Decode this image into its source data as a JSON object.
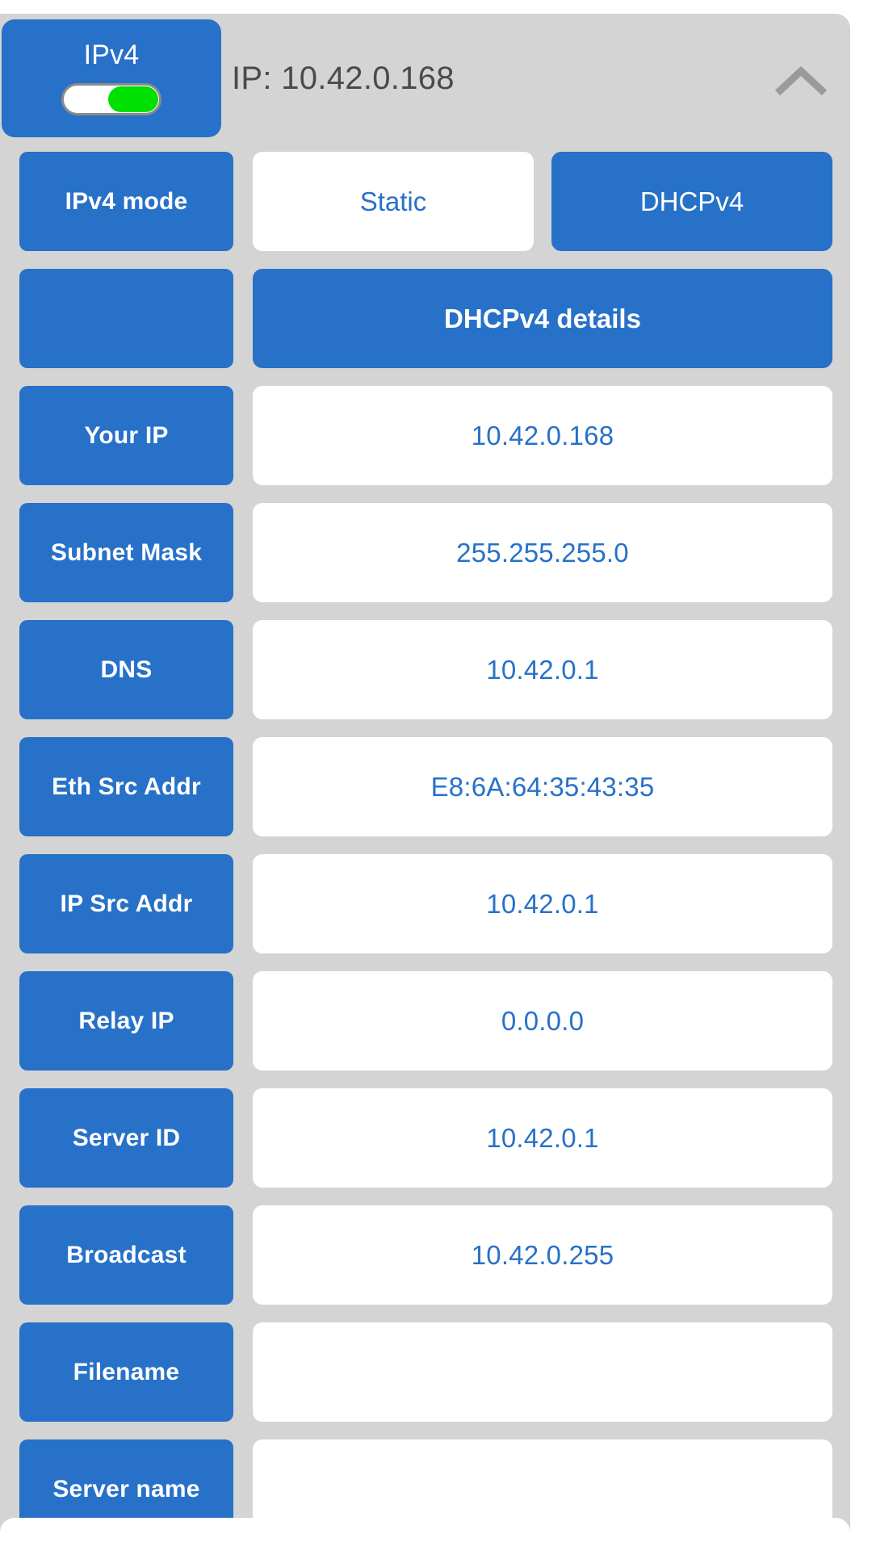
{
  "theme": {
    "accent_blue": "#2771c8",
    "panel_gray": "#d4d4d4",
    "toggle_on_green": "#00e000",
    "header_text_gray": "#4a4a4a",
    "card_white": "#ffffff"
  },
  "header": {
    "protocol_label": "IPv4",
    "toggle_state": "on",
    "ip_summary": "IP: 10.42.0.168",
    "collapse_icon": "chevron-up-icon"
  },
  "mode_row": {
    "label": "IPv4 mode",
    "options": [
      {
        "label": "Static",
        "selected": false
      },
      {
        "label": "DHCPv4",
        "selected": true
      }
    ]
  },
  "details_row": {
    "label": "",
    "button_label": "DHCPv4 details"
  },
  "detail_rows": [
    {
      "label": "Your IP",
      "value": "10.42.0.168"
    },
    {
      "label": "Subnet Mask",
      "value": "255.255.255.0"
    },
    {
      "label": "DNS",
      "value": "10.42.0.1"
    },
    {
      "label": "Eth Src Addr",
      "value": "E8:6A:64:35:43:35"
    },
    {
      "label": "IP Src Addr",
      "value": "10.42.0.1"
    },
    {
      "label": "Relay IP",
      "value": "0.0.0.0"
    },
    {
      "label": "Server ID",
      "value": "10.42.0.1"
    },
    {
      "label": "Broadcast",
      "value": "10.42.0.255"
    },
    {
      "label": "Filename",
      "value": ""
    },
    {
      "label": "Server name",
      "value": ""
    }
  ]
}
